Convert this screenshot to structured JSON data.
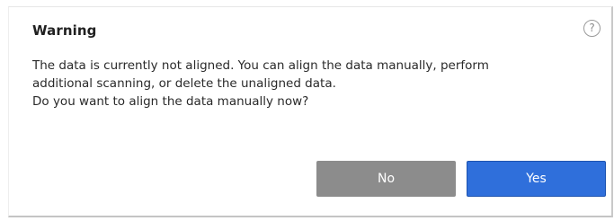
{
  "dialog": {
    "title": "Warning",
    "help_icon": "question-mark-icon",
    "help_glyph": "?",
    "message_lines": [
      "The data is currently not aligned. You can align the data manually, perform",
      "additional scanning, or delete the unaligned data.",
      "Do you want to align the data manually now?"
    ],
    "buttons": {
      "no_label": "No",
      "yes_label": "Yes"
    }
  },
  "colors": {
    "no_button": "#8c8c8c",
    "yes_button": "#2f6fdb"
  }
}
